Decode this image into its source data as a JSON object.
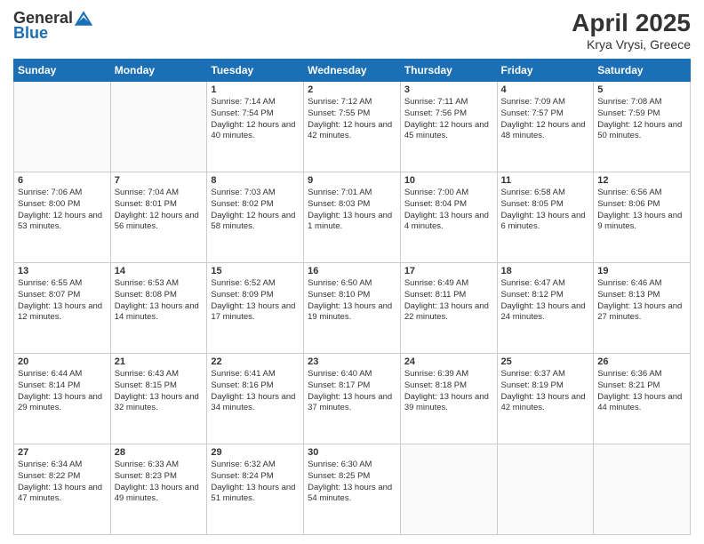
{
  "logo": {
    "general": "General",
    "blue": "Blue"
  },
  "title": "April 2025",
  "subtitle": "Krya Vrysi, Greece",
  "weekdays": [
    "Sunday",
    "Monday",
    "Tuesday",
    "Wednesday",
    "Thursday",
    "Friday",
    "Saturday"
  ],
  "weeks": [
    [
      {
        "day": "",
        "info": ""
      },
      {
        "day": "",
        "info": ""
      },
      {
        "day": "1",
        "info": "Sunrise: 7:14 AM\nSunset: 7:54 PM\nDaylight: 12 hours and 40 minutes."
      },
      {
        "day": "2",
        "info": "Sunrise: 7:12 AM\nSunset: 7:55 PM\nDaylight: 12 hours and 42 minutes."
      },
      {
        "day": "3",
        "info": "Sunrise: 7:11 AM\nSunset: 7:56 PM\nDaylight: 12 hours and 45 minutes."
      },
      {
        "day": "4",
        "info": "Sunrise: 7:09 AM\nSunset: 7:57 PM\nDaylight: 12 hours and 48 minutes."
      },
      {
        "day": "5",
        "info": "Sunrise: 7:08 AM\nSunset: 7:59 PM\nDaylight: 12 hours and 50 minutes."
      }
    ],
    [
      {
        "day": "6",
        "info": "Sunrise: 7:06 AM\nSunset: 8:00 PM\nDaylight: 12 hours and 53 minutes."
      },
      {
        "day": "7",
        "info": "Sunrise: 7:04 AM\nSunset: 8:01 PM\nDaylight: 12 hours and 56 minutes."
      },
      {
        "day": "8",
        "info": "Sunrise: 7:03 AM\nSunset: 8:02 PM\nDaylight: 12 hours and 58 minutes."
      },
      {
        "day": "9",
        "info": "Sunrise: 7:01 AM\nSunset: 8:03 PM\nDaylight: 13 hours and 1 minute."
      },
      {
        "day": "10",
        "info": "Sunrise: 7:00 AM\nSunset: 8:04 PM\nDaylight: 13 hours and 4 minutes."
      },
      {
        "day": "11",
        "info": "Sunrise: 6:58 AM\nSunset: 8:05 PM\nDaylight: 13 hours and 6 minutes."
      },
      {
        "day": "12",
        "info": "Sunrise: 6:56 AM\nSunset: 8:06 PM\nDaylight: 13 hours and 9 minutes."
      }
    ],
    [
      {
        "day": "13",
        "info": "Sunrise: 6:55 AM\nSunset: 8:07 PM\nDaylight: 13 hours and 12 minutes."
      },
      {
        "day": "14",
        "info": "Sunrise: 6:53 AM\nSunset: 8:08 PM\nDaylight: 13 hours and 14 minutes."
      },
      {
        "day": "15",
        "info": "Sunrise: 6:52 AM\nSunset: 8:09 PM\nDaylight: 13 hours and 17 minutes."
      },
      {
        "day": "16",
        "info": "Sunrise: 6:50 AM\nSunset: 8:10 PM\nDaylight: 13 hours and 19 minutes."
      },
      {
        "day": "17",
        "info": "Sunrise: 6:49 AM\nSunset: 8:11 PM\nDaylight: 13 hours and 22 minutes."
      },
      {
        "day": "18",
        "info": "Sunrise: 6:47 AM\nSunset: 8:12 PM\nDaylight: 13 hours and 24 minutes."
      },
      {
        "day": "19",
        "info": "Sunrise: 6:46 AM\nSunset: 8:13 PM\nDaylight: 13 hours and 27 minutes."
      }
    ],
    [
      {
        "day": "20",
        "info": "Sunrise: 6:44 AM\nSunset: 8:14 PM\nDaylight: 13 hours and 29 minutes."
      },
      {
        "day": "21",
        "info": "Sunrise: 6:43 AM\nSunset: 8:15 PM\nDaylight: 13 hours and 32 minutes."
      },
      {
        "day": "22",
        "info": "Sunrise: 6:41 AM\nSunset: 8:16 PM\nDaylight: 13 hours and 34 minutes."
      },
      {
        "day": "23",
        "info": "Sunrise: 6:40 AM\nSunset: 8:17 PM\nDaylight: 13 hours and 37 minutes."
      },
      {
        "day": "24",
        "info": "Sunrise: 6:39 AM\nSunset: 8:18 PM\nDaylight: 13 hours and 39 minutes."
      },
      {
        "day": "25",
        "info": "Sunrise: 6:37 AM\nSunset: 8:19 PM\nDaylight: 13 hours and 42 minutes."
      },
      {
        "day": "26",
        "info": "Sunrise: 6:36 AM\nSunset: 8:21 PM\nDaylight: 13 hours and 44 minutes."
      }
    ],
    [
      {
        "day": "27",
        "info": "Sunrise: 6:34 AM\nSunset: 8:22 PM\nDaylight: 13 hours and 47 minutes."
      },
      {
        "day": "28",
        "info": "Sunrise: 6:33 AM\nSunset: 8:23 PM\nDaylight: 13 hours and 49 minutes."
      },
      {
        "day": "29",
        "info": "Sunrise: 6:32 AM\nSunset: 8:24 PM\nDaylight: 13 hours and 51 minutes."
      },
      {
        "day": "30",
        "info": "Sunrise: 6:30 AM\nSunset: 8:25 PM\nDaylight: 13 hours and 54 minutes."
      },
      {
        "day": "",
        "info": ""
      },
      {
        "day": "",
        "info": ""
      },
      {
        "day": "",
        "info": ""
      }
    ]
  ]
}
